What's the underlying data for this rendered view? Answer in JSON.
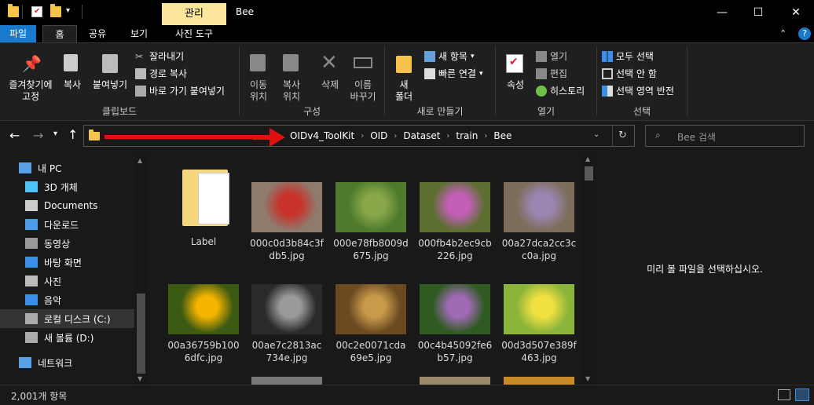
{
  "title_bar": {
    "context_tab": "관리",
    "title": "Bee",
    "minimize": "—",
    "maximize": "☐",
    "close": "✕"
  },
  "ribbon_tabs": [
    "파일",
    "홈",
    "공유",
    "보기",
    "사진 도구"
  ],
  "ribbon": {
    "clipboard": {
      "label": "클립보드",
      "pin": "즐겨찾기에\n고정",
      "copy": "복사",
      "paste": "붙여넣기",
      "cut": "잘라내기",
      "copy_path": "경로 복사",
      "paste_shortcut": "바로 가기 붙여넣기"
    },
    "organize": {
      "label": "구성",
      "move": "이동\n위치",
      "copyto": "복사\n위치",
      "delete": "삭제",
      "rename": "이름\n바꾸기"
    },
    "new": {
      "label": "새로 만들기",
      "new_folder": "새\n폴더",
      "new_item": "새 항목",
      "easy_access": "빠른 연결"
    },
    "open": {
      "label": "열기",
      "properties": "속성",
      "open": "열기",
      "edit": "편집",
      "history": "히스토리"
    },
    "select": {
      "label": "선택",
      "all": "모두 선택",
      "none": "선택 안 함",
      "invert": "선택 영역 반전"
    }
  },
  "address": {
    "crumbs": [
      "OIDv4_ToolKit",
      "OID",
      "Dataset",
      "train",
      "Bee"
    ],
    "search_placeholder": "Bee 검색"
  },
  "nav": [
    {
      "label": "내 PC",
      "icon": "pc-icon"
    },
    {
      "label": "3D 개체",
      "icon": "cube-icon"
    },
    {
      "label": "Documents",
      "icon": "document-icon"
    },
    {
      "label": "다운로드",
      "icon": "download-icon"
    },
    {
      "label": "동영상",
      "icon": "video-icon"
    },
    {
      "label": "바탕 화면",
      "icon": "desktop-icon"
    },
    {
      "label": "사진",
      "icon": "picture-icon"
    },
    {
      "label": "음악",
      "icon": "music-icon"
    },
    {
      "label": "로컬 디스크 (C:)",
      "icon": "drive-icon"
    },
    {
      "label": "새 볼륨 (D:)",
      "icon": "drive-icon"
    },
    {
      "label": "네트워크",
      "icon": "network-icon"
    }
  ],
  "files": [
    {
      "name": "Label",
      "kind": "folder"
    },
    {
      "name": "000c0d3b84c3fdb5.jpg",
      "kind": "image",
      "c1": "#8f7a6c",
      "c2": "#c8322a"
    },
    {
      "name": "000e78fb8009d675.jpg",
      "kind": "image",
      "c1": "#4e7a2c",
      "c2": "#8aa84a"
    },
    {
      "name": "000fb4b2ec9cb226.jpg",
      "kind": "image",
      "c1": "#5c6e30",
      "c2": "#c45fb8"
    },
    {
      "name": "00a27dca2cc3cc0a.jpg",
      "kind": "image",
      "c1": "#7d6e5c",
      "c2": "#9b86b4"
    },
    {
      "name": "00a36759b1006dfc.jpg",
      "kind": "image",
      "c1": "#3d5a12",
      "c2": "#f4b400"
    },
    {
      "name": "00ae7c2813ac734e.jpg",
      "kind": "image",
      "c1": "#2a2a2a",
      "c2": "#9a9a9a"
    },
    {
      "name": "00c2e0071cda69e5.jpg",
      "kind": "image",
      "c1": "#6b4a22",
      "c2": "#c89a4a"
    },
    {
      "name": "00c4b45092fe6b57.jpg",
      "kind": "image",
      "c1": "#2f5a22",
      "c2": "#a06ab4"
    },
    {
      "name": "00d3d507e389f463.jpg",
      "kind": "image",
      "c1": "#8ab43a",
      "c2": "#f0e040"
    }
  ],
  "preview": {
    "message": "미리 볼 파일을 선택하십시오."
  },
  "status": {
    "count": "2,001개 항목"
  }
}
